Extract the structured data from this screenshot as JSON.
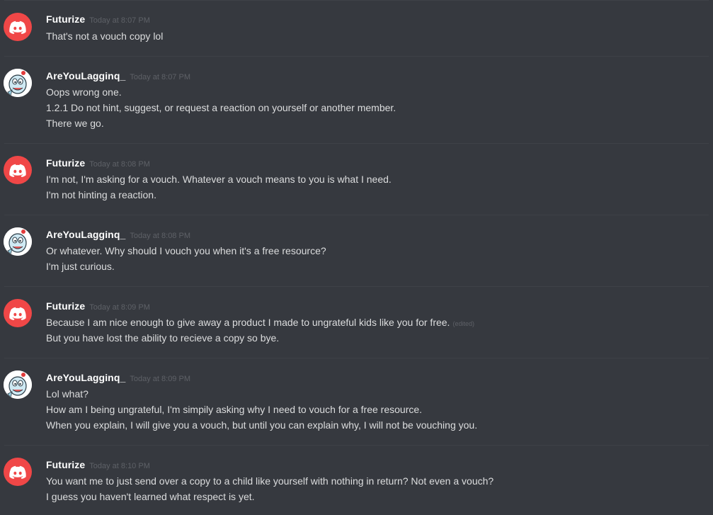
{
  "messages": [
    {
      "username": "Futurize",
      "timestamp": "Today at 8:07 PM",
      "avatar": "discord-logo-icon",
      "lines": [
        "That's not a vouch copy lol"
      ]
    },
    {
      "username": "AreYouLagginq_",
      "timestamp": "Today at 8:07 PM",
      "avatar": "cartoon-character-icon",
      "lines": [
        "Oops wrong one.",
        "1.2.1 Do not hint, suggest, or request a reaction on yourself or another member.",
        "There we go."
      ]
    },
    {
      "username": "Futurize",
      "timestamp": "Today at 8:08 PM",
      "avatar": "discord-logo-icon",
      "lines": [
        "I'm not, I'm asking for a vouch.  Whatever a vouch means to you is what I need.",
        "I'm not hinting a reaction."
      ]
    },
    {
      "username": "AreYouLagginq_",
      "timestamp": "Today at 8:08 PM",
      "avatar": "cartoon-character-icon",
      "lines": [
        "Or whatever. Why should I vouch you when it's a free resource?",
        "I'm just curious."
      ]
    },
    {
      "username": "Futurize",
      "timestamp": "Today at 8:09 PM",
      "avatar": "discord-logo-icon",
      "lines": [
        "Because I am nice enough to give away a product I made to ungrateful kids like you for free.",
        "But you have lost the ability to recieve a copy so bye."
      ],
      "edited_label": "(edited)"
    },
    {
      "username": "AreYouLagginq_",
      "timestamp": "Today at 8:09 PM",
      "avatar": "cartoon-character-icon",
      "lines": [
        "Lol what?",
        "How am I being ungrateful, I'm simpily asking why I need to vouch for a free resource.",
        "When you explain, I will give you a vouch, but until you can explain why, I will not be vouching you."
      ]
    },
    {
      "username": "Futurize",
      "timestamp": "Today at 8:10 PM",
      "avatar": "discord-logo-icon",
      "lines": [
        "You want me to just send over a copy to a child like yourself with nothing in return?  Not even a vouch?",
        "I guess you haven't learned what respect is yet."
      ]
    }
  ],
  "colors": {
    "background": "#36393f",
    "username": "#ffffff",
    "message_text": "#dcddde",
    "timestamp": "#5e6167",
    "discord_red": "#f04747"
  }
}
